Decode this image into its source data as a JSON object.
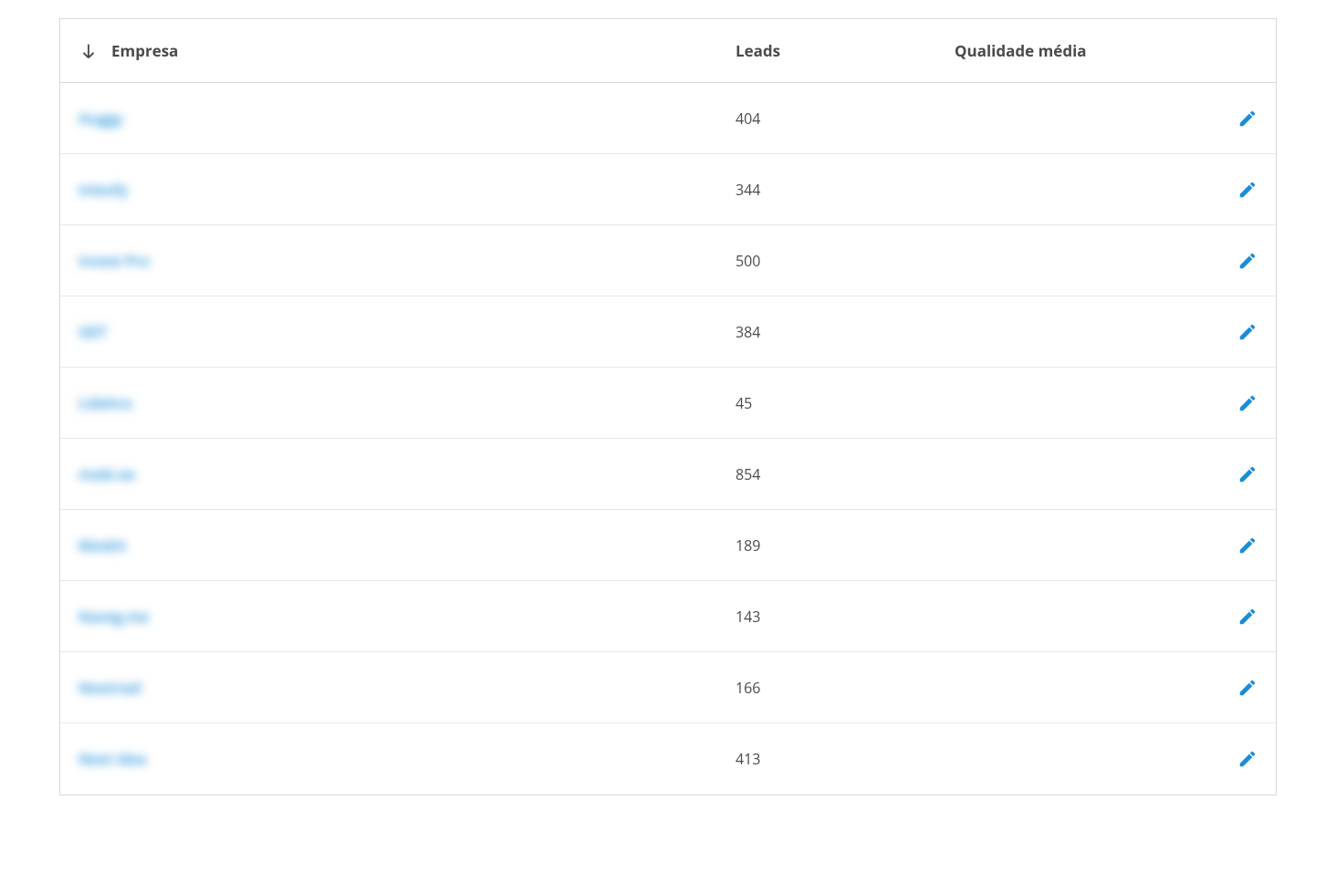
{
  "table": {
    "columns": {
      "empresa": "Empresa",
      "leads": "Leads",
      "qualidade": "Qualidade média"
    },
    "rows": [
      {
        "empresa": "Huggy",
        "leads": "404",
        "qualidade": ""
      },
      {
        "empresa": "Intexfy",
        "leads": "344",
        "qualidade": ""
      },
      {
        "empresa": "Invest Pro",
        "leads": "500",
        "qualidade": ""
      },
      {
        "empresa": "iSET",
        "leads": "384",
        "qualidade": ""
      },
      {
        "empresa": "Lidehra",
        "leads": "45",
        "qualidade": ""
      },
      {
        "empresa": "mobi.ee",
        "leads": "854",
        "qualidade": ""
      },
      {
        "empresa": "Moskit",
        "leads": "189",
        "qualidade": ""
      },
      {
        "empresa": "Naveg.me",
        "leads": "143",
        "qualidade": ""
      },
      {
        "empresa": "Neotriad",
        "leads": "166",
        "qualidade": ""
      },
      {
        "empresa": "Next Idea",
        "leads": "413",
        "qualidade": ""
      }
    ]
  },
  "colors": {
    "link": "#1a8cd8",
    "text": "#4a4a4a",
    "border": "#d8d8d8"
  }
}
